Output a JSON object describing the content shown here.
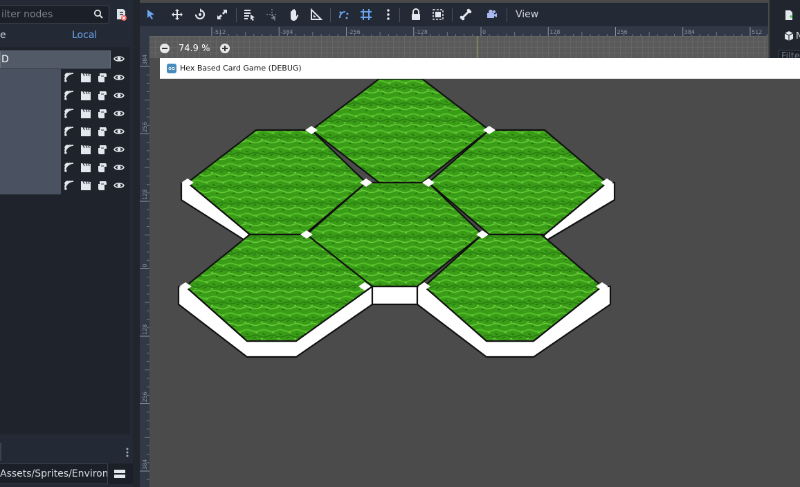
{
  "scene_dock": {
    "filter_placeholder": "ilter nodes",
    "tab_scene": "e",
    "tab_local": "Local",
    "root_node_label": "D"
  },
  "toolbar": {
    "view_menu": "View"
  },
  "ruler": {
    "top_labels": [
      "-512",
      "-384",
      "-256",
      "-128",
      "0",
      "128",
      "256",
      "384",
      "512"
    ],
    "left_labels": [
      "384",
      "256",
      "128",
      "0",
      "128",
      "256",
      "384"
    ]
  },
  "zoom": {
    "level": "74.9 %"
  },
  "game_window": {
    "title": "Hex Based Card Game (DEBUG)"
  },
  "filesystem": {
    "path": "Assets/Sprites/Environ"
  },
  "right_dock": {
    "node_label": "N",
    "filter_placeholder": "Filte"
  },
  "colors": {
    "editor_bg": "#20252e",
    "panel_bg": "#242a35",
    "accent": "#6aa6f0",
    "viewport_bg": "#4b4b4b",
    "grass_green": "#3a9d18",
    "tile_outline": "#111111"
  }
}
